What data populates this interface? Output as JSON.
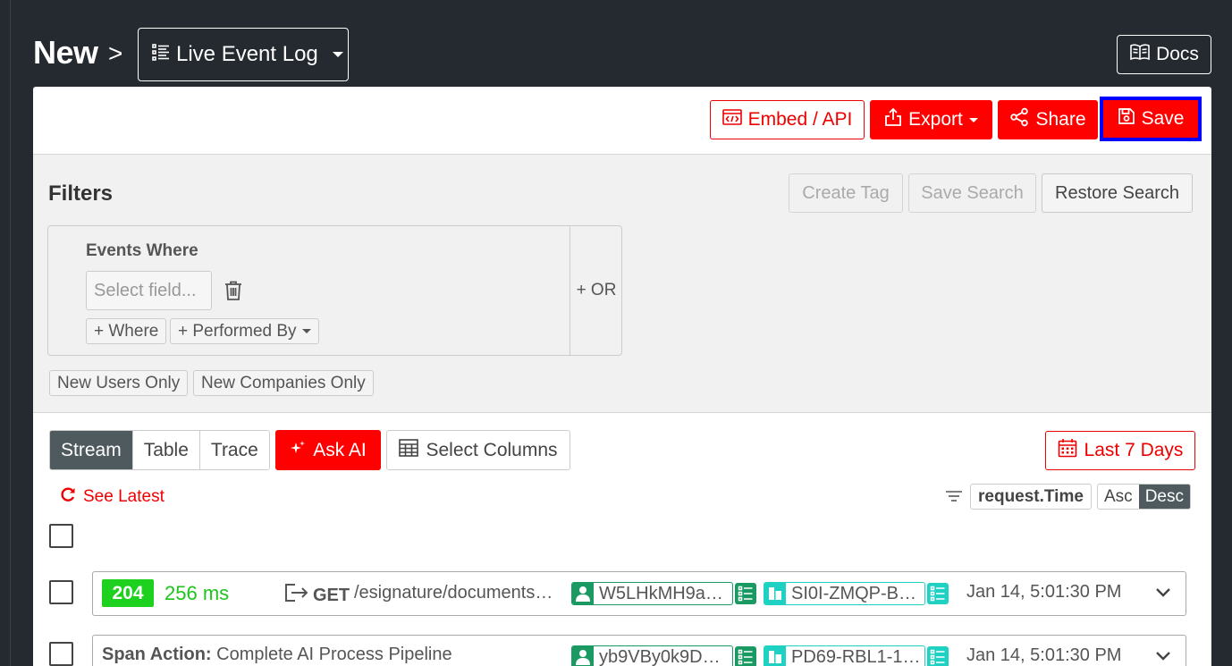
{
  "header": {
    "crumb_root": "New",
    "crumb_sep": ">",
    "view_name": "Live Event Log",
    "docs_label": "Docs"
  },
  "toolbar": {
    "embed_label": "Embed / API",
    "export_label": "Export",
    "share_label": "Share",
    "save_label": "Save"
  },
  "filters": {
    "title": "Filters",
    "create_tag": "Create Tag",
    "save_search": "Save Search",
    "restore_search": "Restore Search",
    "events_where": "Events Where",
    "select_field_placeholder": "Select field...",
    "add_where": "+ Where",
    "performed_by": "+ Performed By",
    "or_label": "+ OR",
    "new_users_only": "New Users Only",
    "new_companies_only": "New Companies Only"
  },
  "results": {
    "views": [
      "Stream",
      "Table",
      "Trace"
    ],
    "active_view": "Stream",
    "ask_ai": "Ask AI",
    "select_columns": "Select Columns",
    "date_range": "Last 7 Days",
    "see_latest": "See Latest",
    "sort_field": "request.Time",
    "sort_asc": "Asc",
    "sort_desc": "Desc",
    "sort_active": "Desc"
  },
  "events": [
    {
      "status": "204",
      "duration": "256 ms",
      "method": "GET",
      "path": "/esignature/documents…",
      "user": "W5LHkMH9a…",
      "company": "SI0I-ZMQP-B…",
      "time": "Jan 14, 5:01:30 PM"
    },
    {
      "span_label": "Span Action:",
      "span_name": "Complete AI Process Pipeline",
      "user": "yb9VBy0k9D…",
      "company": "PD69-RBL1-1…",
      "time": "Jan 14, 5:01:30 PM"
    }
  ],
  "colors": {
    "accent_red": "#ff0000",
    "status_ok": "#1fd11f",
    "user_chip": "#1a9a62",
    "company_chip": "#1fd1c2",
    "dark_bg": "#242a30"
  },
  "icons": {
    "view": "list-icon",
    "docs": "book-icon",
    "embed": "code-icon",
    "export": "upload-icon",
    "share": "share-icon",
    "save": "floppy-icon",
    "trash": "trash-icon",
    "ai": "sparkle-icon",
    "columns": "table-icon",
    "calendar": "calendar-icon",
    "refresh": "refresh-icon",
    "sort": "filter-lines-icon"
  }
}
